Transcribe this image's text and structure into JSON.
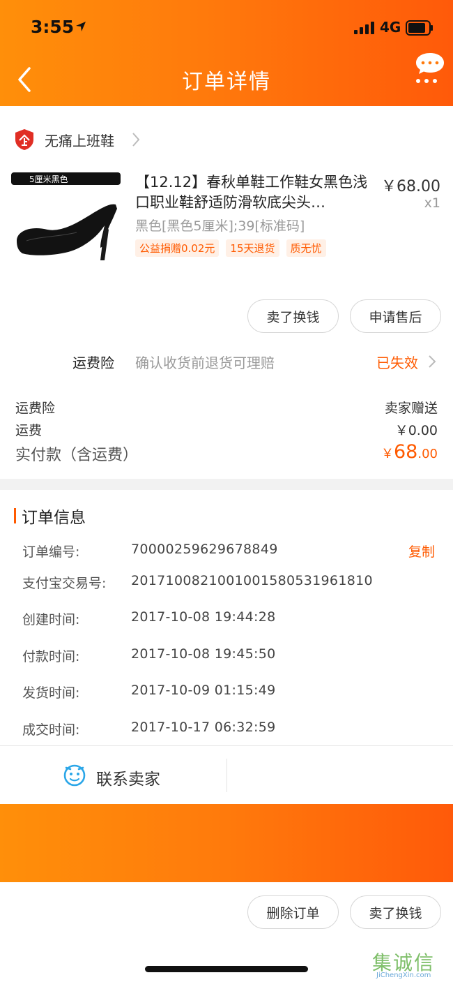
{
  "status_bar": {
    "time": "3:55",
    "network": "4G"
  },
  "nav": {
    "title": "订单详情"
  },
  "shop": {
    "name": "无痛上班鞋"
  },
  "product": {
    "image_label": "5厘米黑色",
    "title": "【12.12】春秋单鞋工作鞋女黑色浅口职业鞋舒适防滑软底尖头…",
    "price": "￥68.00",
    "quantity": "x1",
    "sku": "黑色[黑色5厘米];39[标准码]",
    "tags": [
      "公益捐赠0.02元",
      "15天退货",
      "质无忧"
    ]
  },
  "item_actions": {
    "sell_label": "卖了换钱",
    "after_sale_label": "申请售后"
  },
  "freight_insurance": {
    "label": "运费险",
    "description": "确认收货前退货可理赔",
    "status": "已失效"
  },
  "fees": {
    "insurance_label": "运费险",
    "insurance_value": "卖家赠送",
    "shipping_label": "运费",
    "shipping_value": "￥0.00",
    "paid_label": "实付款（含运费）",
    "paid_currency": "￥",
    "paid_integer": "68",
    "paid_decimal": ".00"
  },
  "order_info": {
    "title": "订单信息",
    "copy_label": "复制",
    "rows": [
      {
        "label": "订单编号:",
        "value": "70000259629678849"
      },
      {
        "label": "支付宝交易号:",
        "value": "2017100821001001580531961810"
      },
      {
        "label": "创建时间:",
        "value": "2017-10-08 19:44:28"
      },
      {
        "label": "付款时间:",
        "value": "2017-10-08 19:45:50"
      },
      {
        "label": "发货时间:",
        "value": "2017-10-09 01:15:49"
      },
      {
        "label": "成交时间:",
        "value": "2017-10-17 06:32:59"
      }
    ]
  },
  "contact": {
    "label": "联系卖家"
  },
  "bottom_actions": {
    "delete_label": "删除订单",
    "sell_label": "卖了换钱"
  },
  "watermark": {
    "chinese": "集诚信",
    "english": "JiChengXin.com"
  },
  "colors": {
    "accent": "#ff5a00",
    "header_start": "#ff8f0a",
    "header_end": "#ff5a0a"
  }
}
